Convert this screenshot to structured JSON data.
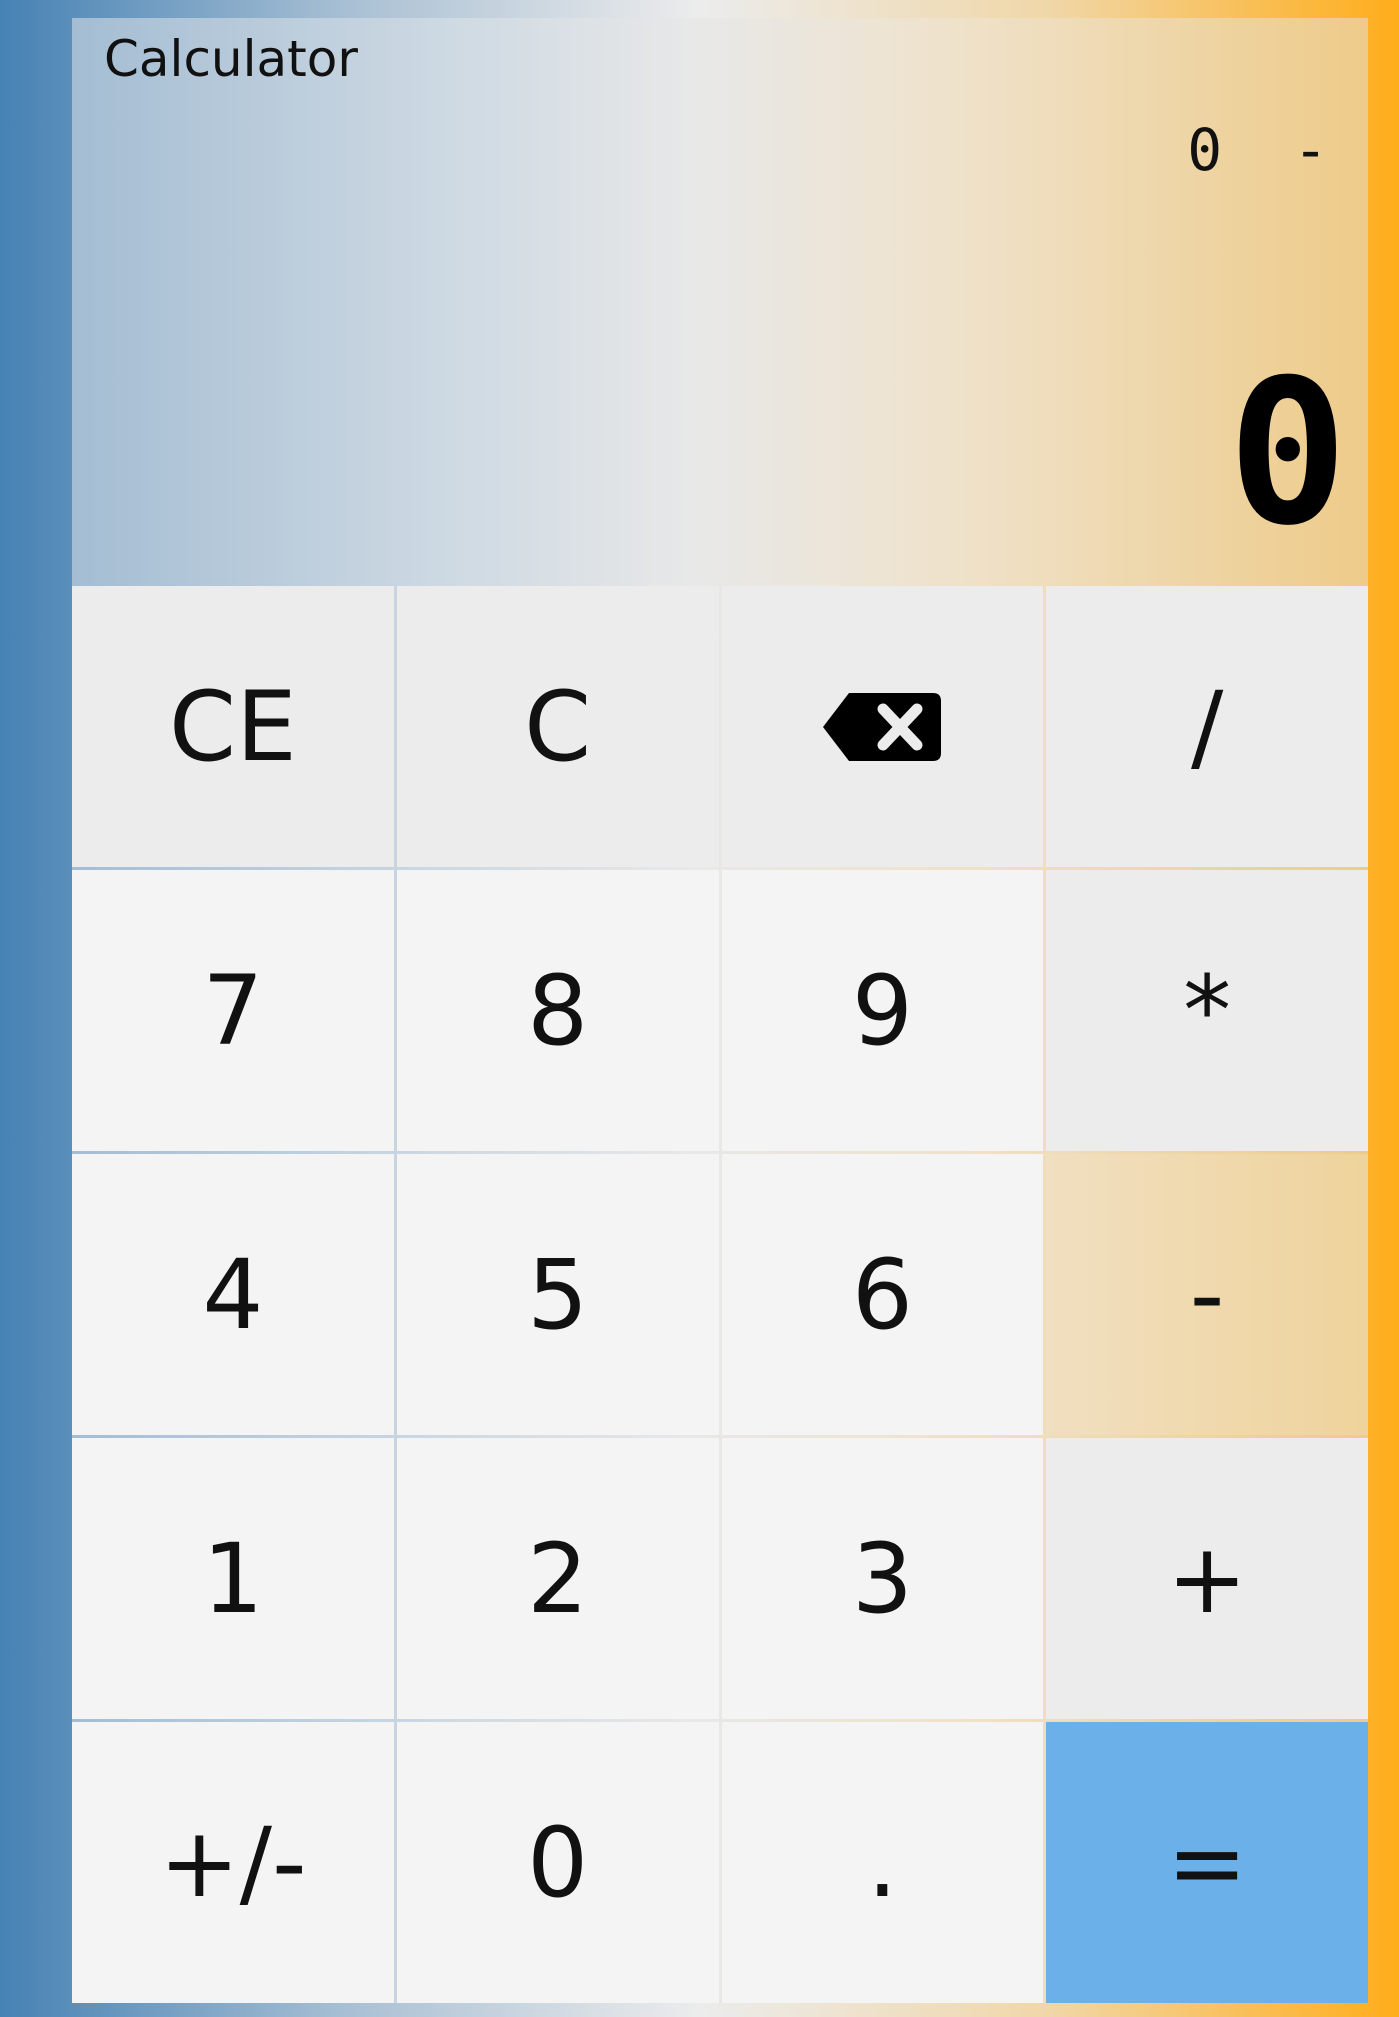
{
  "app": {
    "title": "Calculator"
  },
  "display": {
    "expression": "0 -",
    "result": "0"
  },
  "keys": {
    "ce": "CE",
    "c": "C",
    "backspace_icon": "backspace-icon",
    "divide": "/",
    "seven": "7",
    "eight": "8",
    "nine": "9",
    "multiply": "*",
    "four": "4",
    "five": "5",
    "six": "6",
    "minus": "-",
    "one": "1",
    "two": "2",
    "three": "3",
    "plus": "+",
    "negate": "+/-",
    "zero": "0",
    "decimal": ".",
    "equals": "="
  },
  "colors": {
    "equals_button": "#6cb0ea",
    "operator_button": "#ececec",
    "number_button": "#f4f4f4",
    "background_left": "#4682b4",
    "background_right": "#ffad1a"
  }
}
